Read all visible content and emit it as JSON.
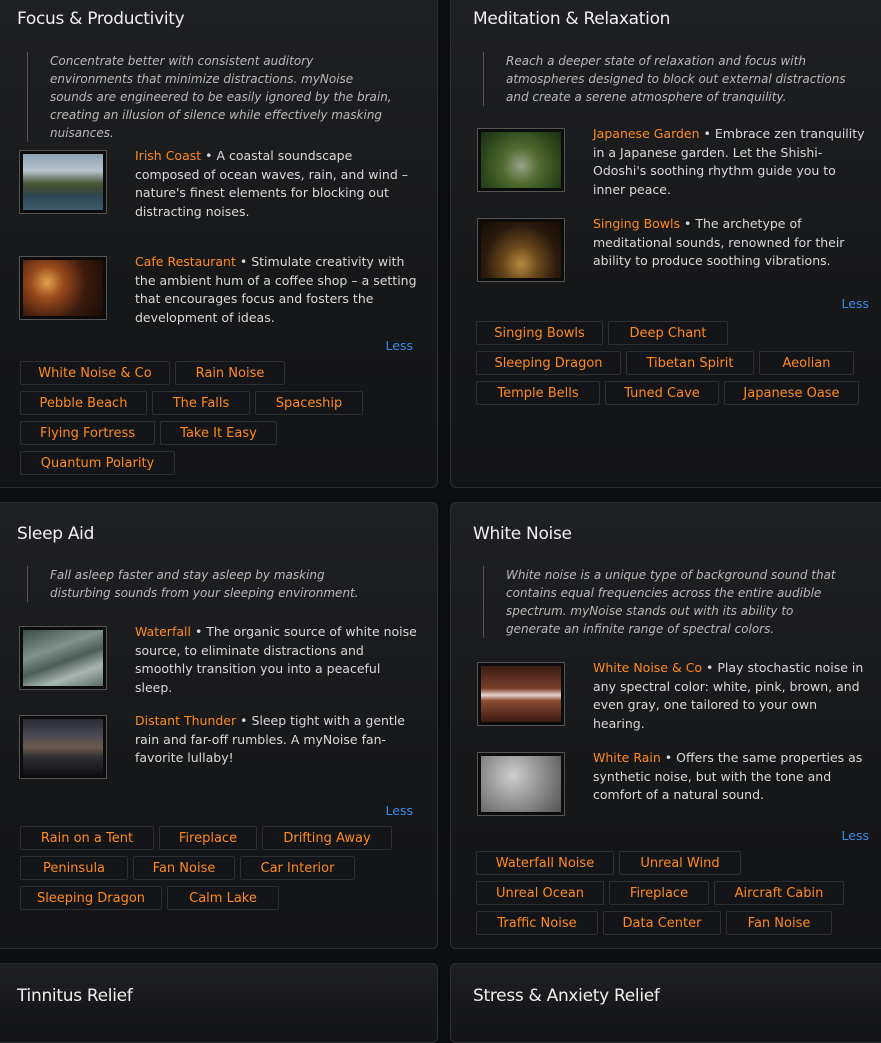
{
  "cards": {
    "focus": {
      "title": "Focus & Productivity",
      "intro": "Concentrate better with consistent auditory environments that minimize distractions. myNoise sounds are engineered to be easily ignored by the brain, creating an illusion of silence while effectively masking nuisances.",
      "features": [
        {
          "title": "Irish Coast",
          "text": " • A coastal soundscape composed of ocean waves, rain, and wind – nature's finest elements for blocking out distracting noises."
        },
        {
          "title": "Cafe Restaurant",
          "text": " • Stimulate creativity with the ambient hum of a coffee shop – a setting that encourages focus and fosters the development of ideas."
        }
      ],
      "less": "Less",
      "tags": [
        "White Noise & Co",
        "Rain Noise",
        "Pebble Beach",
        "The Falls",
        "Spaceship",
        "Flying Fortress",
        "Take It Easy",
        "Quantum Polarity"
      ]
    },
    "meditation": {
      "title": "Meditation & Relaxation",
      "intro": "Reach a deeper state of relaxation and focus with atmospheres designed to block out external distractions and create a serene atmosphere of tranquility.",
      "features": [
        {
          "title": "Japanese Garden",
          "text": " • Embrace zen tranquility in a Japanese garden. Let the Shishi-Odoshi's soothing rhythm guide you to inner peace."
        },
        {
          "title": "Singing Bowls",
          "text": " • The archetype of meditational sounds, renowned for their ability to produce soothing vibrations."
        }
      ],
      "less": "Less",
      "tags": [
        "Singing Bowls",
        "Deep Chant",
        "Sleeping Dragon",
        "Tibetan Spirit",
        "Aeolian",
        "Temple Bells",
        "Tuned Cave",
        "Japanese Oase"
      ]
    },
    "sleep": {
      "title": "Sleep Aid",
      "intro": "Fall asleep faster and stay asleep by masking disturbing sounds from your sleeping environment.",
      "features": [
        {
          "title": "Waterfall",
          "text": " • The organic source of white noise source, to eliminate distractions and smoothly transition you into a peaceful sleep."
        },
        {
          "title": "Distant Thunder",
          "text": " • Sleep tight with a gentle rain and far-off rumbles. A myNoise fan-favorite lullaby!"
        }
      ],
      "less": "Less",
      "tags": [
        "Rain on a Tent",
        "Fireplace",
        "Drifting Away",
        "Peninsula",
        "Fan Noise",
        "Car Interior",
        "Sleeping Dragon",
        "Calm Lake"
      ]
    },
    "white": {
      "title": "White Noise",
      "intro": "White noise is a unique type of background sound that contains equal frequencies across the entire audible spectrum. myNoise stands out with its ability to generate an infinite range of spectral colors.",
      "features": [
        {
          "title": "White Noise & Co",
          "text": " • Play stochastic noise in any spectral color: white, pink, brown, and even gray, one tailored to your own hearing."
        },
        {
          "title": "White Rain",
          "text": " • Offers the same properties as synthetic noise, but with the tone and comfort of a natural sound."
        }
      ],
      "less": "Less",
      "tags": [
        "Waterfall Noise",
        "Unreal Wind",
        "Unreal Ocean",
        "Fireplace",
        "Aircraft Cabin",
        "Traffic Noise",
        "Data Center",
        "Fan Noise"
      ]
    },
    "tinnitus": {
      "title": "Tinnitus Relief"
    },
    "stress": {
      "title": "Stress & Anxiety Relief"
    }
  },
  "colors": {
    "accent": "#ff8a1e",
    "link": "#3b8be8",
    "card_bg": "#1c1d20"
  }
}
